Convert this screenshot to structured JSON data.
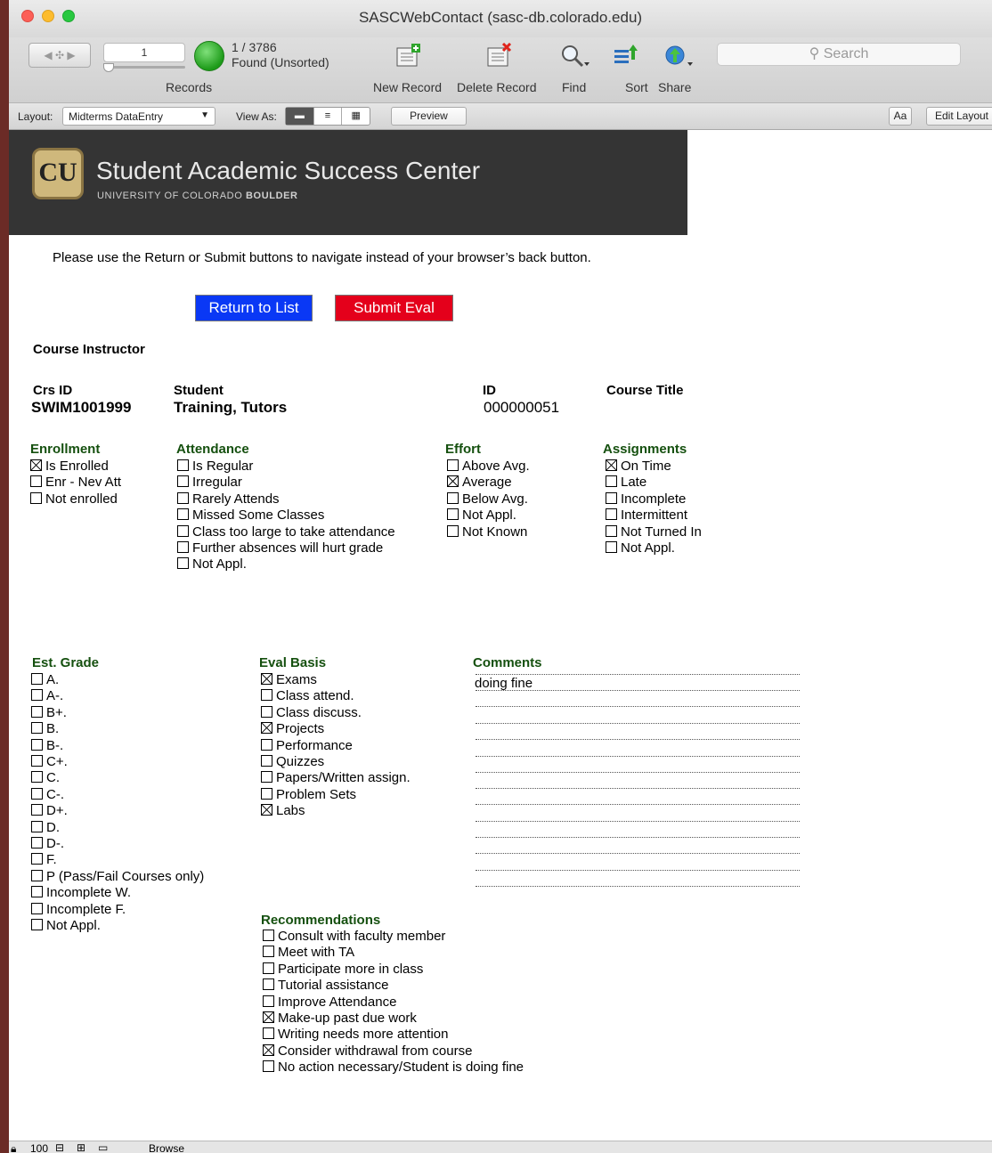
{
  "window": {
    "title": "SASCWebContact (sasc-db.colorado.edu)"
  },
  "toolbar": {
    "record_number": "1",
    "record_count": "1 / 3786",
    "found_status": "Found (Unsorted)",
    "records_label": "Records",
    "new_record_label": "New Record",
    "delete_record_label": "Delete Record",
    "find_label": "Find",
    "sort_label": "Sort",
    "share_label": "Share",
    "search_placeholder": "Search",
    "search_icon": "magnifier-icon"
  },
  "layout_bar": {
    "layout_label": "Layout:",
    "layout_value": "Midterms DataEntry",
    "view_as_label": "View As:",
    "preview_label": "Preview",
    "font_button": "Aa",
    "edit_layout_label": "Edit Layout"
  },
  "banner": {
    "title": "Student Academic Success Center",
    "subtitle_prefix": "UNIVERSITY OF COLORADO ",
    "subtitle_bold": "BOULDER",
    "logo_text": "CU"
  },
  "instructions": "Please use the Return or Submit buttons to navigate instead of your browser’s back button.",
  "buttons": {
    "return": "Return to List",
    "submit": "Submit Eval",
    "return_color": "#0a38f5",
    "submit_color": "#e4001b"
  },
  "info": {
    "course_instructor_label": "Course Instructor",
    "crs_id_label": "Crs ID",
    "crs_id": "SWIM1001999",
    "student_label": "Student",
    "student": "Training, Tutors",
    "id_label": "ID",
    "id": "000000051",
    "course_title_label": "Course Title"
  },
  "enrollment": {
    "title": "Enrollment",
    "items": [
      {
        "label": "Is Enrolled",
        "checked": true
      },
      {
        "label": "Enr - Nev Att",
        "checked": false
      },
      {
        "label": "Not enrolled",
        "checked": false
      }
    ]
  },
  "attendance": {
    "title": "Attendance",
    "items": [
      {
        "label": "Is Regular",
        "checked": false
      },
      {
        "label": "Irregular",
        "checked": false
      },
      {
        "label": "Rarely Attends",
        "checked": false
      },
      {
        "label": "Missed Some Classes",
        "checked": false
      },
      {
        "label": "Class too large to take attendance",
        "checked": false
      },
      {
        "label": "Further absences will hurt grade",
        "checked": false
      },
      {
        "label": "Not Appl.",
        "checked": false
      }
    ]
  },
  "effort": {
    "title": "Effort",
    "items": [
      {
        "label": "Above Avg.",
        "checked": false
      },
      {
        "label": "Average",
        "checked": true
      },
      {
        "label": "Below Avg.",
        "checked": false
      },
      {
        "label": "Not Appl.",
        "checked": false
      },
      {
        "label": "Not Known",
        "checked": false
      }
    ]
  },
  "assignments": {
    "title": "Assignments",
    "items": [
      {
        "label": "On Time",
        "checked": true
      },
      {
        "label": "Late",
        "checked": false
      },
      {
        "label": "Incomplete",
        "checked": false
      },
      {
        "label": "Intermittent",
        "checked": false
      },
      {
        "label": "Not Turned In",
        "checked": false
      },
      {
        "label": "Not Appl.",
        "checked": false
      }
    ]
  },
  "est_grade": {
    "title": "Est. Grade",
    "items": [
      {
        "label": "A.",
        "checked": false
      },
      {
        "label": "A-.",
        "checked": false
      },
      {
        "label": "B+.",
        "checked": false
      },
      {
        "label": "B.",
        "checked": false
      },
      {
        "label": "B-.",
        "checked": false
      },
      {
        "label": "C+.",
        "checked": false
      },
      {
        "label": "C.",
        "checked": false
      },
      {
        "label": "C-.",
        "checked": false
      },
      {
        "label": "D+.",
        "checked": false
      },
      {
        "label": "D.",
        "checked": false
      },
      {
        "label": "D-.",
        "checked": false
      },
      {
        "label": "F.",
        "checked": false
      },
      {
        "label": "P (Pass/Fail Courses only)",
        "checked": false
      },
      {
        "label": "Incomplete W.",
        "checked": false
      },
      {
        "label": "Incomplete F.",
        "checked": false
      },
      {
        "label": "Not Appl.",
        "checked": false
      }
    ]
  },
  "eval_basis": {
    "title": "Eval Basis",
    "items": [
      {
        "label": "Exams",
        "checked": true
      },
      {
        "label": "Class attend.",
        "checked": false
      },
      {
        "label": "Class discuss.",
        "checked": false
      },
      {
        "label": "Projects",
        "checked": true
      },
      {
        "label": "Performance",
        "checked": false
      },
      {
        "label": "Quizzes",
        "checked": false
      },
      {
        "label": "Papers/Written assign.",
        "checked": false
      },
      {
        "label": "Problem Sets",
        "checked": false
      },
      {
        "label": "Labs",
        "checked": true
      }
    ]
  },
  "comments": {
    "title": "Comments",
    "text": "doing fine"
  },
  "recommendations": {
    "title": "Recommendations",
    "items": [
      {
        "label": "Consult with faculty member",
        "checked": false
      },
      {
        "label": "Meet with TA",
        "checked": false
      },
      {
        "label": "Participate more in class",
        "checked": false
      },
      {
        "label": "Tutorial assistance",
        "checked": false
      },
      {
        "label": "Improve Attendance",
        "checked": false
      },
      {
        "label": "Make-up past due work",
        "checked": true
      },
      {
        "label": "Writing needs more attention",
        "checked": false
      },
      {
        "label": "Consider withdrawal from course",
        "checked": true
      },
      {
        "label": "No action necessary/Student is doing fine",
        "checked": false
      }
    ]
  },
  "statusbar": {
    "zoom": "100",
    "mode": "Browse"
  }
}
